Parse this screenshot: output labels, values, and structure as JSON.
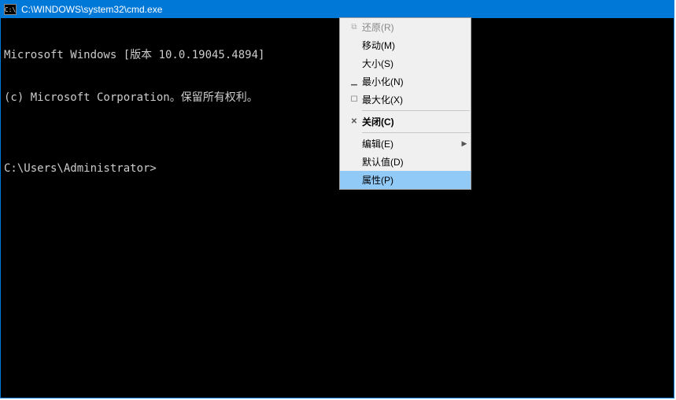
{
  "window": {
    "title": "C:\\WINDOWS\\system32\\cmd.exe",
    "icon_glyph": "C:\\"
  },
  "terminal": {
    "line1": "Microsoft Windows [版本 10.0.19045.4894]",
    "line2": "(c) Microsoft Corporation。保留所有权利。",
    "line3": "",
    "line4": "C:\\Users\\Administrator>"
  },
  "menu": {
    "restore": "还原(R)",
    "move": "移动(M)",
    "size": "大小(S)",
    "minimize": "最小化(N)",
    "maximize": "最大化(X)",
    "close": "关闭(C)",
    "edit": "编辑(E)",
    "defaults": "默认值(D)",
    "properties": "属性(P)"
  }
}
